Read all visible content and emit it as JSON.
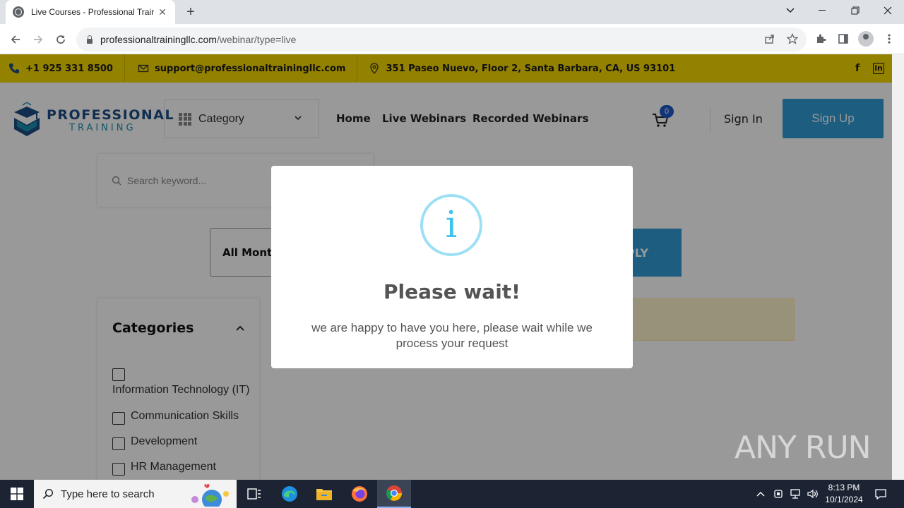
{
  "browser": {
    "tab_title": "Live Courses - Professional Trair",
    "tab_close": "✕",
    "new_tab": "+",
    "url_host": "professionaltrainingllc.com",
    "url_path": "/webinar/type=live"
  },
  "topbar": {
    "phone": "+1 925 331 8500",
    "email": "support@professionaltrainingllc.com",
    "address": "351 Paseo Nuevo, Floor 2, Santa Barbara, CA, US 93101",
    "social": [
      "f",
      "in"
    ],
    "bg_color": "#f6d700"
  },
  "header": {
    "logo_line1": "PROFESSIONAL",
    "logo_line2": "TRAINING",
    "category_label": "Category",
    "nav": [
      "Home",
      "Live Webinars",
      "Recorded Webinars"
    ],
    "cart_count": "0",
    "sign_in": "Sign In",
    "sign_up": "Sign Up"
  },
  "filters": {
    "search_placeholder": "Search keyword...",
    "month_value": "All Month",
    "apply_label": "PLY"
  },
  "categories": {
    "heading": "Categories",
    "items": [
      "Information Technology (IT)",
      "Communication Skills",
      "Development",
      "HR Management"
    ]
  },
  "modal": {
    "icon": "i",
    "title": "Please wait!",
    "text": "we are happy to have you here, please wait while we process your request"
  },
  "watermark": {
    "text": "ANY RUN"
  },
  "taskbar": {
    "search_placeholder": "Type here to search",
    "time": "8:13 PM",
    "date": "10/1/2024"
  },
  "colors": {
    "accent": "#2f9bd5",
    "brand_dark": "#1d4d86",
    "info": "#3fc3ee"
  }
}
